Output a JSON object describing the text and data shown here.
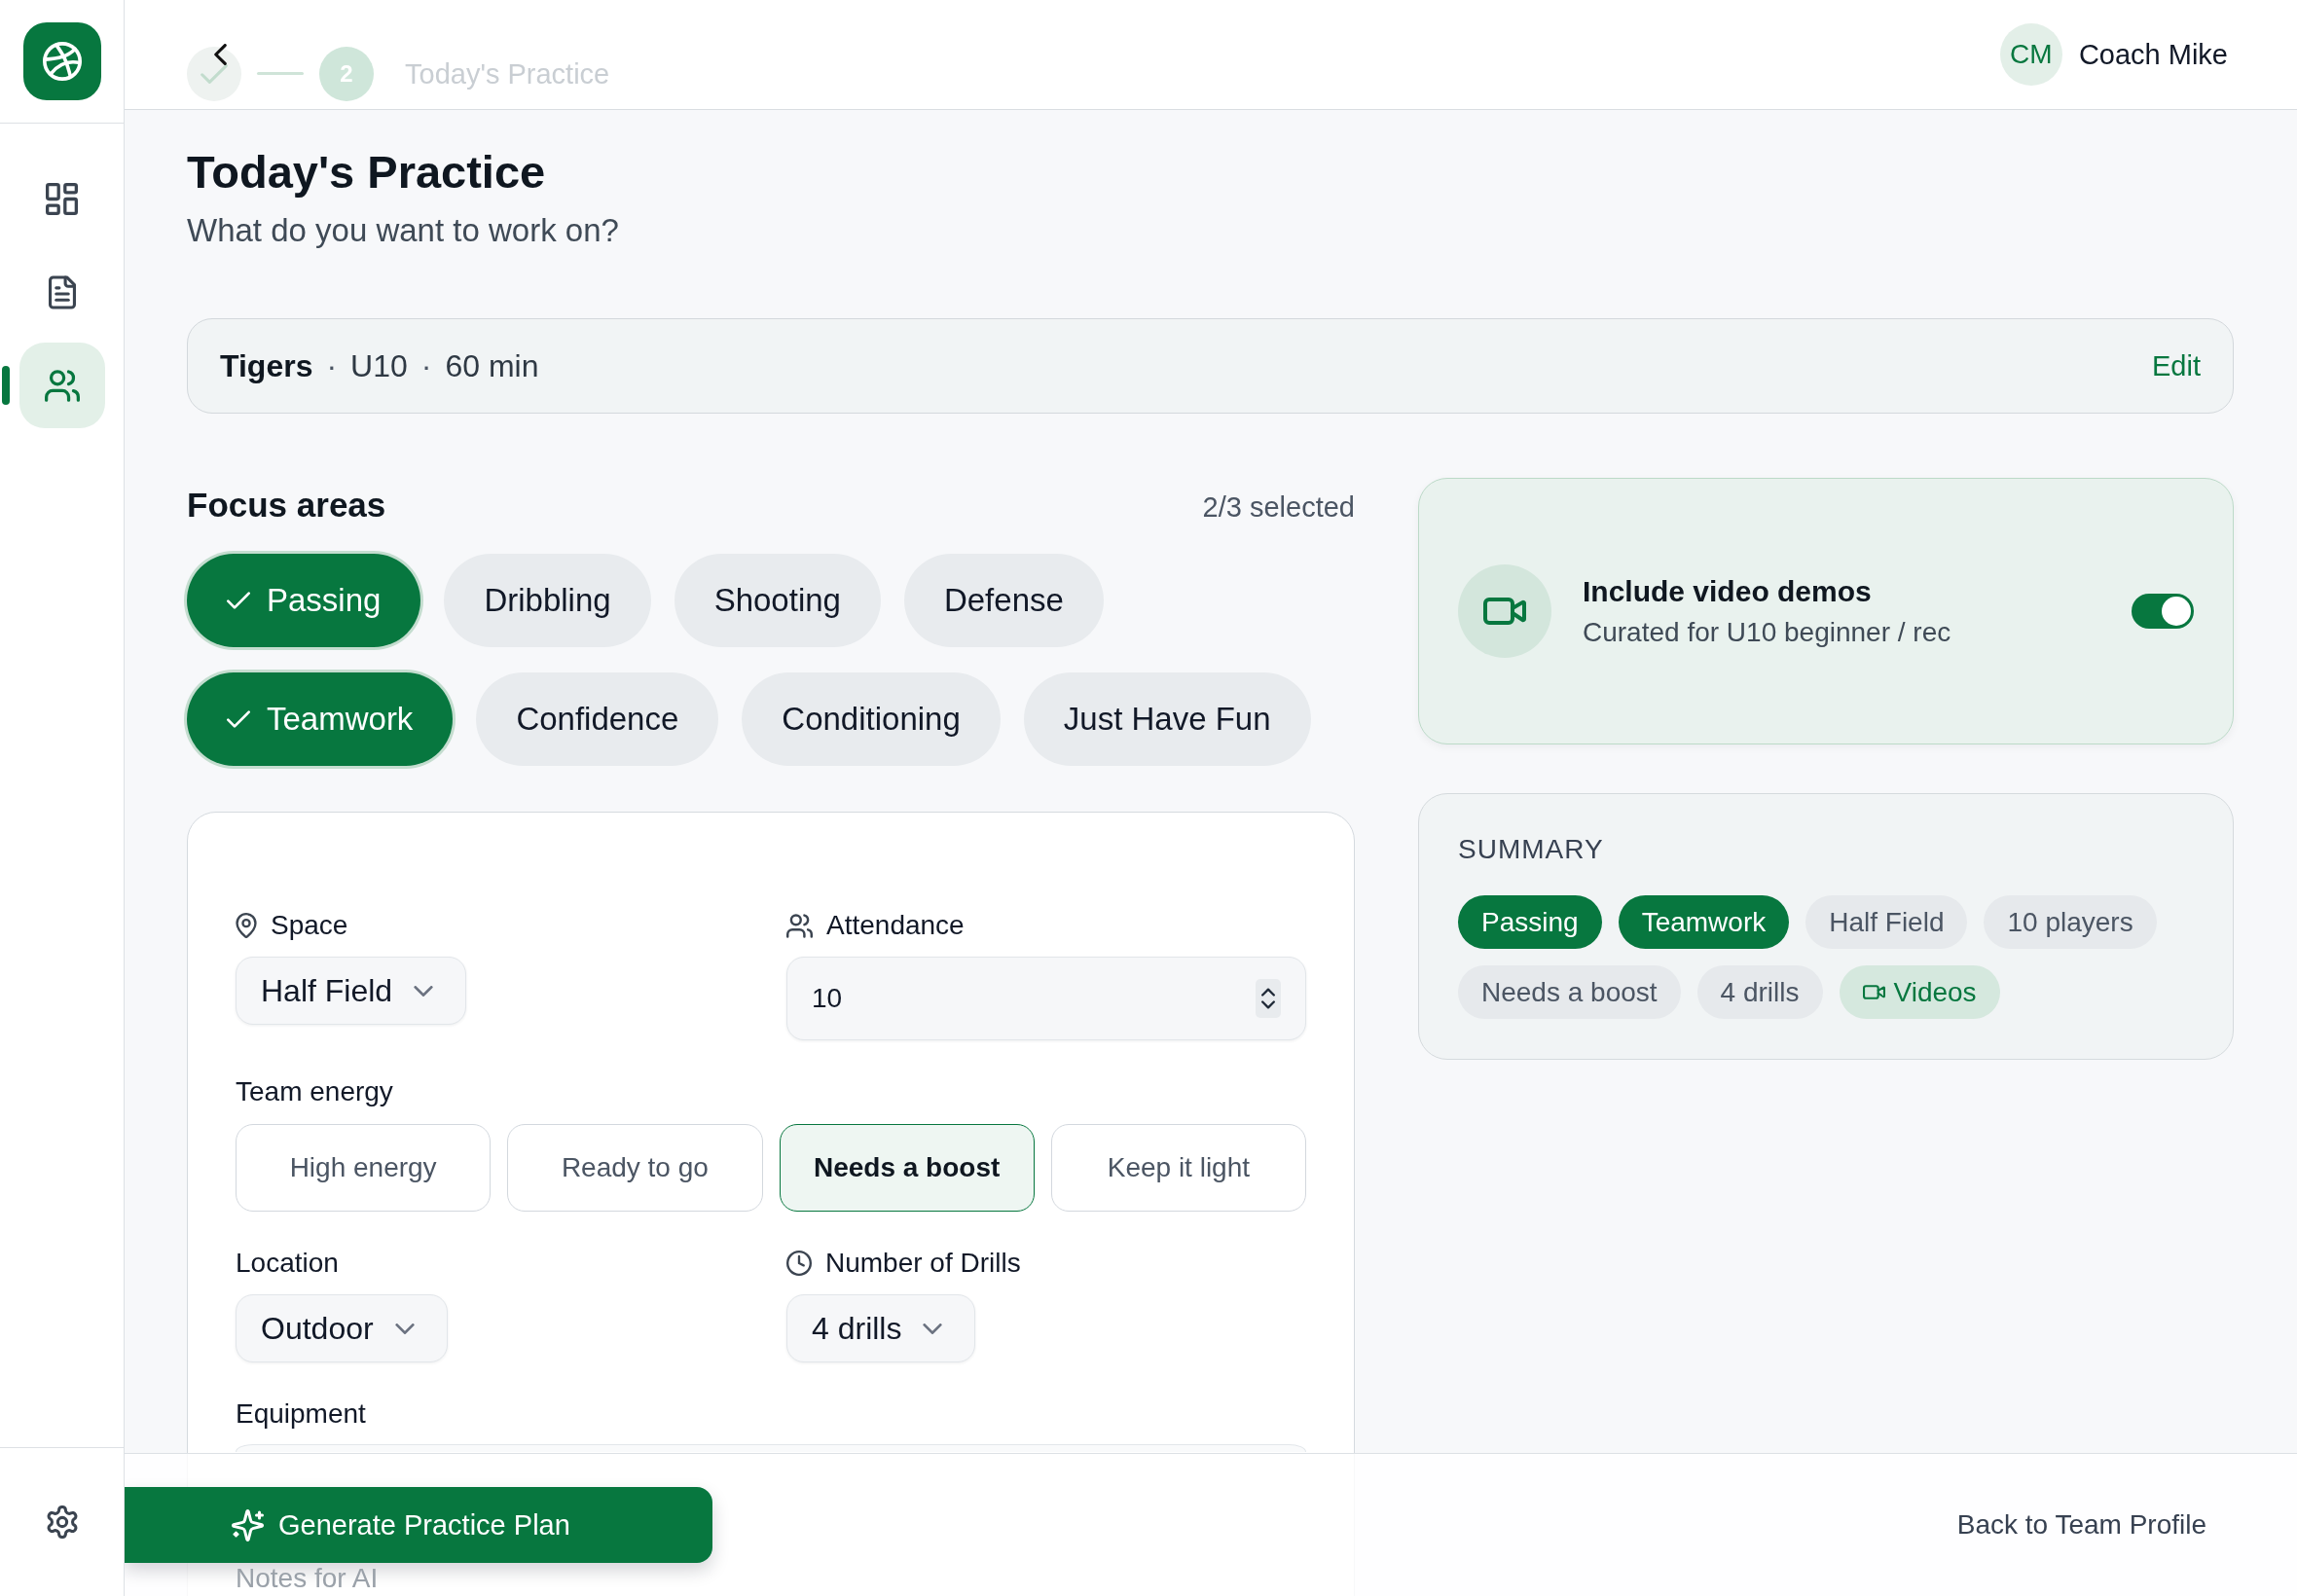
{
  "sidebar": {
    "nav_items": [
      {
        "selected": false
      },
      {
        "selected": false
      },
      {
        "selected": true
      }
    ]
  },
  "header": {
    "steps": [
      {
        "done": true
      },
      {
        "done": false,
        "number": "2"
      }
    ],
    "step_label": "Today's Practice",
    "user": {
      "initials": "CM",
      "name": "Coach Mike"
    }
  },
  "page": {
    "title": "Today's Practice",
    "subtitle": "What do you want to work on?"
  },
  "team_bar": {
    "team": "Tigers",
    "separator": "·",
    "details": [
      "U10",
      "60 min"
    ],
    "action": "Edit"
  },
  "focus_areas": {
    "title": "Focus areas",
    "count": "2/3 selected",
    "chips": [
      {
        "label": "Passing",
        "selected": true
      },
      {
        "label": "Dribbling",
        "selected": false
      },
      {
        "label": "Shooting",
        "selected": false
      },
      {
        "label": "Defense",
        "selected": false
      },
      {
        "label": "Teamwork",
        "selected": true
      },
      {
        "label": "Confidence",
        "selected": false
      },
      {
        "label": "Conditioning",
        "selected": false
      },
      {
        "label": "Just Have Fun",
        "selected": false
      }
    ]
  },
  "form": {
    "space": {
      "label": "Space",
      "value": "Half Field"
    },
    "attendance": {
      "label": "Attendance",
      "value": "10"
    },
    "team_energy": {
      "label": "Team energy",
      "options": [
        {
          "label": "High energy",
          "selected": false
        },
        {
          "label": "Ready to go",
          "selected": false
        },
        {
          "label": "Needs a boost",
          "selected": true
        },
        {
          "label": "Keep it light",
          "selected": false
        }
      ]
    },
    "location": {
      "label": "Location",
      "value": "Outdoor"
    },
    "drills": {
      "label": "Number of Drills",
      "value": "4 drills"
    },
    "equipment": {
      "label": "Equipment"
    },
    "notes": {
      "label": "Notes for AI"
    }
  },
  "video_demos": {
    "title": "Include video demos",
    "subtitle": "Curated for U10 beginner / rec",
    "on": true
  },
  "summary": {
    "title": "SUMMARY",
    "tags": [
      {
        "label": "Passing",
        "kind": "focus"
      },
      {
        "label": "Teamwork",
        "kind": "focus"
      },
      {
        "label": "Half Field",
        "kind": "detail"
      },
      {
        "label": "10 players",
        "kind": "detail"
      },
      {
        "label": "Needs a boost",
        "kind": "detail"
      },
      {
        "label": "4 drills",
        "kind": "detail"
      },
      {
        "label": "Videos",
        "kind": "video"
      }
    ]
  },
  "footer": {
    "primary_button": "Generate Practice Plan",
    "back_link": "Back to Team Profile"
  }
}
